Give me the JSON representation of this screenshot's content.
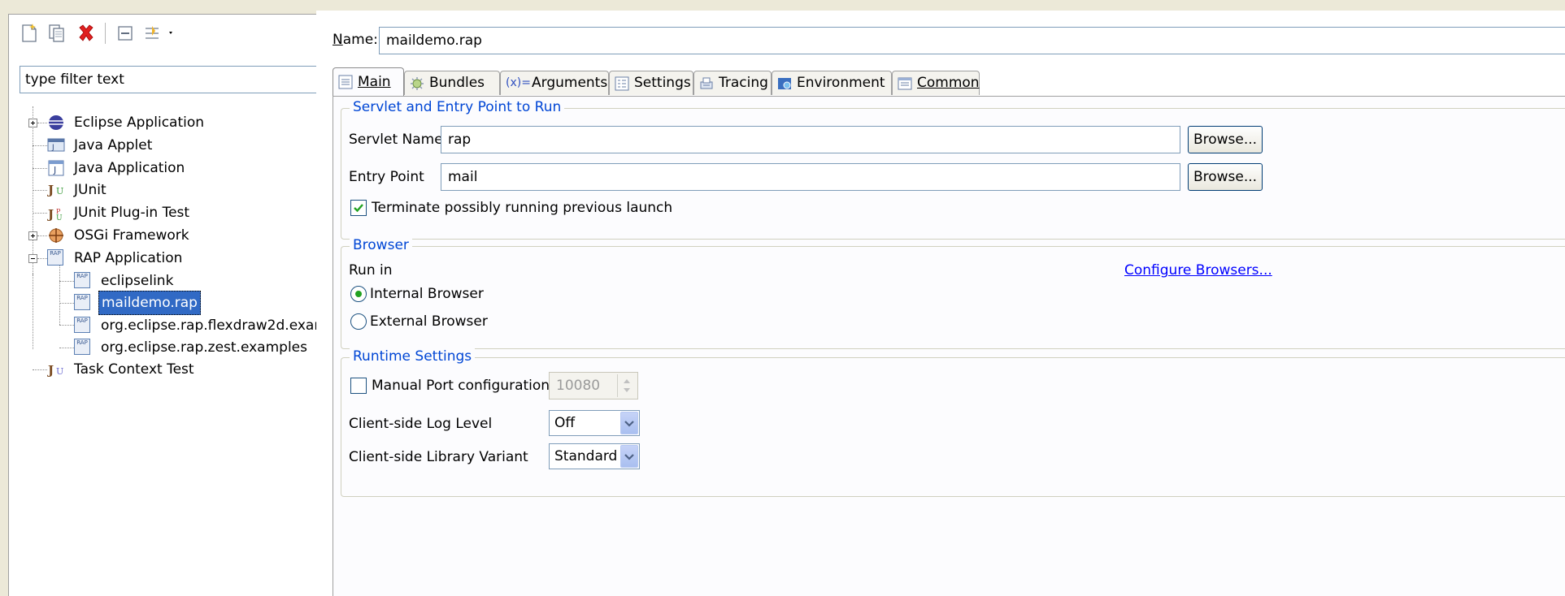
{
  "left_panel": {
    "toolbar": {
      "new_icon": "new-launch-config-icon",
      "duplicate_icon": "duplicate-icon",
      "delete_icon": "delete-icon",
      "collapse_icon": "collapse-all-icon",
      "filter_icon": "filter-icon"
    },
    "filter_placeholder": "type filter text",
    "filter_value": "type filter text",
    "tree": [
      {
        "label": "Eclipse Application",
        "icon": "eclipse-icon",
        "expander": "plus"
      },
      {
        "label": "Java Applet",
        "icon": "java-applet-icon"
      },
      {
        "label": "Java Application",
        "icon": "java-application-icon"
      },
      {
        "label": "JUnit",
        "icon": "junit-icon"
      },
      {
        "label": "JUnit Plug-in Test",
        "icon": "junit-plugin-icon"
      },
      {
        "label": "OSGi Framework",
        "icon": "osgi-icon",
        "expander": "plus"
      },
      {
        "label": "RAP Application",
        "icon": "rap-icon",
        "expander": "minus"
      },
      {
        "label": "eclipselink",
        "icon": "rap-icon"
      },
      {
        "label": "maildemo.rap",
        "icon": "rap-icon",
        "selected": true
      },
      {
        "label": "org.eclipse.rap.flexdraw2d.exan",
        "icon": "rap-icon"
      },
      {
        "label": "org.eclipse.rap.zest.examples",
        "icon": "rap-icon"
      },
      {
        "label": "Task Context Test",
        "icon": "task-context-icon"
      }
    ]
  },
  "name": {
    "label_u": "N",
    "label_rest": "ame:",
    "value": "maildemo.rap"
  },
  "tabs": [
    {
      "label": "Main",
      "icon": "main-tab-icon",
      "active": true
    },
    {
      "label": "Bundles",
      "icon": "bundles-icon"
    },
    {
      "label": "Arguments",
      "icon": "arguments-icon",
      "prefix": "(x)="
    },
    {
      "label": "Settings",
      "icon": "settings-icon"
    },
    {
      "label": "Tracing",
      "icon": "tracing-icon"
    },
    {
      "label": "Environment",
      "icon": "environment-icon"
    },
    {
      "label": "Common",
      "icon": "common-icon"
    }
  ],
  "servlet_group": {
    "title": "Servlet and Entry Point to Run",
    "servlet_name_label": "Servlet Name",
    "servlet_name_value": "rap",
    "entry_point_label": "Entry Point",
    "entry_point_value": "mail",
    "browse_label": "Browse...",
    "terminate_label": "Terminate possibly running previous launch",
    "terminate_checked": true
  },
  "browser_group": {
    "title": "Browser",
    "run_in_label": "Run in",
    "configure_link": "Configure Browsers...",
    "internal_label": "Internal Browser",
    "external_label": "External Browser",
    "selected": "internal"
  },
  "runtime_group": {
    "title": "Runtime Settings",
    "manual_port_label": "Manual Port configuration",
    "manual_port_checked": false,
    "port_value": "10080",
    "log_level_label": "Client-side Log Level",
    "log_level_value": "Off",
    "library_variant_label": "Client-side Library Variant",
    "library_variant_value": "Standard"
  }
}
